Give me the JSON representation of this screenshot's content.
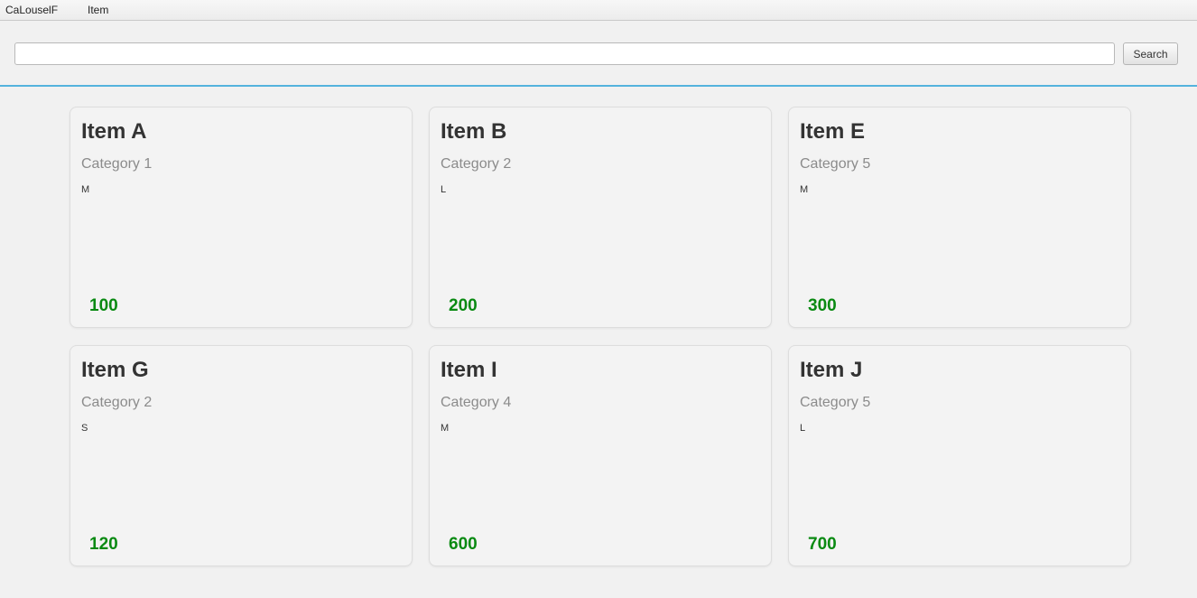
{
  "menu": {
    "items": [
      {
        "label": "CaLouselF"
      },
      {
        "label": "Item"
      }
    ]
  },
  "search": {
    "value": "",
    "placeholder": "",
    "button_label": "Search"
  },
  "colors": {
    "accent_divider": "#54b3dd",
    "price": "#0a8a12"
  },
  "cards": [
    {
      "title": "Item A",
      "category": "Category 1",
      "size": "M",
      "price": "100"
    },
    {
      "title": "Item B",
      "category": "Category 2",
      "size": "L",
      "price": "200"
    },
    {
      "title": "Item E",
      "category": "Category 5",
      "size": "M",
      "price": "300"
    },
    {
      "title": "Item G",
      "category": "Category 2",
      "size": "S",
      "price": "120"
    },
    {
      "title": "Item I",
      "category": "Category 4",
      "size": "M",
      "price": "600"
    },
    {
      "title": "Item J",
      "category": "Category 5",
      "size": "L",
      "price": "700"
    }
  ]
}
